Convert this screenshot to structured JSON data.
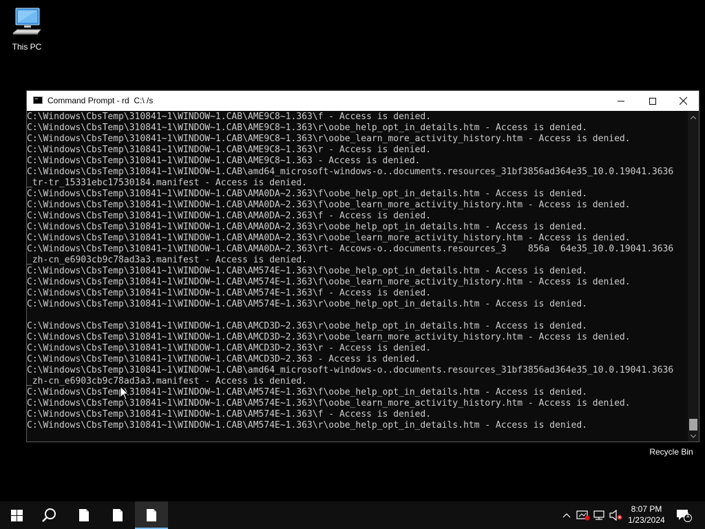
{
  "desktop": {
    "icons": [
      {
        "label": "This PC"
      },
      {
        "label": "Recycle Bin"
      }
    ]
  },
  "window": {
    "title": "Command Prompt - rd  C:\\ /s",
    "controls": {
      "minimize": "minimize",
      "maximize": "maximize",
      "close": "close"
    }
  },
  "console": {
    "lines": [
      "C:\\Windows\\CbsTemp\\310841~1\\WINDOW~1.CAB\\AME9C8~1.363\\f - Access is denied.",
      "C:\\Windows\\CbsTemp\\310841~1\\WINDOW~1.CAB\\AME9C8~1.363\\r\\oobe_help_opt_in_details.htm - Access is denied.",
      "C:\\Windows\\CbsTemp\\310841~1\\WINDOW~1.CAB\\AME9C8~1.363\\r\\oobe_learn_more_activity_history.htm - Access is denied.",
      "C:\\Windows\\CbsTemp\\310841~1\\WINDOW~1.CAB\\AME9C8~1.363\\r - Access is denied.",
      "C:\\Windows\\CbsTemp\\310841~1\\WINDOW~1.CAB\\AME9C8~1.363 - Access is denied.",
      "C:\\Windows\\CbsTemp\\310841~1\\WINDOW~1.CAB\\amd64_microsoft-windows-o..documents.resources_31bf3856ad364e35_10.0.19041.3636",
      "_tr-tr_15331ebc17530184.manifest - Access is denied.",
      "C:\\Windows\\CbsTemp\\310841~1\\WINDOW~1.CAB\\AMA0DA~2.363\\f\\oobe_help_opt_in_details.htm - Access is denied.",
      "C:\\Windows\\CbsTemp\\310841~1\\WINDOW~1.CAB\\AMA0DA~2.363\\f\\oobe_learn_more_activity_history.htm - Access is denied.",
      "C:\\Windows\\CbsTemp\\310841~1\\WINDOW~1.CAB\\AMA0DA~2.363\\f - Access is denied.",
      "C:\\Windows\\CbsTemp\\310841~1\\WINDOW~1.CAB\\AMA0DA~2.363\\r\\oobe_help_opt_in_details.htm - Access is denied.",
      "C:\\Windows\\CbsTemp\\310841~1\\WINDOW~1.CAB\\AMA0DA~2.363\\r\\oobe_learn_more_activity_history.htm - Access is denied.",
      "C:\\Windows\\CbsTemp\\310841~1\\WINDOW~1.CAB\\AMA0DA~2.363\\rt- Accows-o..documents.resources_3    856a  64e35_10.0.19041.3636",
      "_zh-cn_e6903cb9c78ad3a3.manifest - Access is denied.",
      "C:\\Windows\\CbsTemp\\310841~1\\WINDOW~1.CAB\\AM574E~1.363\\f\\oobe_help_opt_in_details.htm - Access is denied.",
      "C:\\Windows\\CbsTemp\\310841~1\\WINDOW~1.CAB\\AM574E~1.363\\f\\oobe_learn_more_activity_history.htm - Access is denied.",
      "C:\\Windows\\CbsTemp\\310841~1\\WINDOW~1.CAB\\AM574E~1.363\\f - Access is denied.",
      "C:\\Windows\\CbsTemp\\310841~1\\WINDOW~1.CAB\\AM574E~1.363\\r\\oobe_help_opt_in_details.htm - Access is denied.",
      "",
      "C:\\Windows\\CbsTemp\\310841~1\\WINDOW~1.CAB\\AMCD3D~2.363\\r\\oobe_help_opt_in_details.htm - Access is denied.",
      "C:\\Windows\\CbsTemp\\310841~1\\WINDOW~1.CAB\\AMCD3D~2.363\\r\\oobe_learn_more_activity_history.htm - Access is denied.",
      "C:\\Windows\\CbsTemp\\310841~1\\WINDOW~1.CAB\\AMCD3D~2.363\\r - Access is denied.",
      "C:\\Windows\\CbsTemp\\310841~1\\WINDOW~1.CAB\\AMCD3D~2.363 - Access is denied.",
      "C:\\Windows\\CbsTemp\\310841~1\\WINDOW~1.CAB\\amd64_microsoft-windows-o..documents.resources_31bf3856ad364e35_10.0.19041.3636",
      "_zh-cn_e6903cb9c78ad3a3.manifest - Access is denied.",
      "C:\\Windows\\CbsTemp\\310841~1\\WINDOW~1.CAB\\AM574E~1.363\\f\\oobe_help_opt_in_details.htm - Access is denied.",
      "C:\\Windows\\CbsTemp\\310841~1\\WINDOW~1.CAB\\AM574E~1.363\\f\\oobe_learn_more_activity_history.htm - Access is denied.",
      "C:\\Windows\\CbsTemp\\310841~1\\WINDOW~1.CAB\\AM574E~1.363\\f - Access is denied.",
      "C:\\Windows\\CbsTemp\\310841~1\\WINDOW~1.CAB\\AM574E~1.363\\r\\oobe_help_opt_in_details.htm - Access is denied."
    ]
  },
  "taskbar": {
    "buttons": [
      {
        "name": "start-button",
        "icon": "windows-logo-icon"
      },
      {
        "name": "search-button",
        "icon": "search-icon"
      },
      {
        "name": "taskbar-app-1",
        "icon": "document-icon"
      },
      {
        "name": "taskbar-app-2",
        "icon": "document-icon"
      },
      {
        "name": "taskbar-app-3-active",
        "icon": "document-icon"
      }
    ],
    "tray": {
      "time": "8:07 PM",
      "date": "1/23/2024",
      "notification_count": "1"
    }
  },
  "colors": {
    "console_bg": "#0c0c0c",
    "console_text": "#cccccc",
    "taskbar_bg": "#101010",
    "accent": "#76b9ed"
  }
}
